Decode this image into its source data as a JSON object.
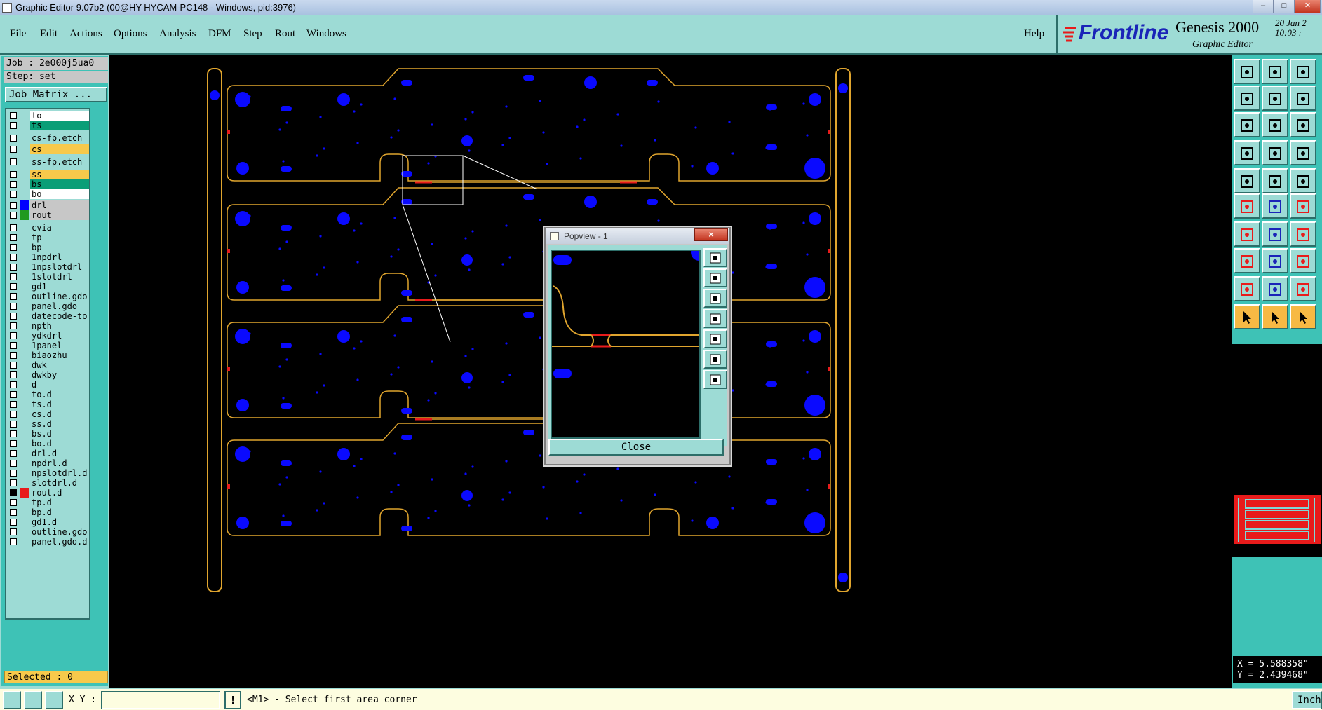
{
  "window": {
    "title": "Graphic Editor 9.07b2 (00@HY-HYCAM-PC148 - Windows, pid:3976)"
  },
  "menu": {
    "items": [
      "File",
      "Edit",
      "Actions",
      "Options",
      "Analysis",
      "DFM",
      "Step",
      "Rout",
      "Windows"
    ],
    "help": "Help"
  },
  "brand": {
    "logo": "Frontline",
    "product": "Genesis 2000",
    "subtitle": "Graphic Editor",
    "date": "20 Jan 2",
    "time": "10:03 :"
  },
  "job": {
    "job_label": "Job : 2e000j5ua0",
    "step_label": "Step: set",
    "matrix_button": "Job Matrix ..."
  },
  "layers": [
    {
      "name": "to",
      "color": "#ffffff",
      "checked": false
    },
    {
      "name": "ts",
      "color": "#0a9e77",
      "checked": false
    },
    {
      "name": "cs-fp.etch",
      "color": "#9ddbd5",
      "checked": false
    },
    {
      "name": "cs",
      "color": "#f7c94b",
      "checked": false
    },
    {
      "name": "ss-fp.etch",
      "color": "#9ddbd5",
      "checked": false
    },
    {
      "name": "ss",
      "color": "#f7c94b",
      "checked": false
    },
    {
      "name": "bs",
      "color": "#0a9e77",
      "checked": false
    },
    {
      "name": "bo",
      "color": "#ffffff",
      "checked": false
    },
    {
      "name": "drl",
      "color": "#c7c7c7",
      "swatch": "#0000ff",
      "checked": false
    },
    {
      "name": "rout",
      "color": "#c7c7c7",
      "swatch": "#1f9a1f",
      "checked": false
    },
    {
      "name": "cvia",
      "color": "#9ddbd5",
      "checked": false
    },
    {
      "name": "tp",
      "color": "#9ddbd5",
      "checked": false
    },
    {
      "name": "bp",
      "color": "#9ddbd5",
      "checked": false
    },
    {
      "name": "1npdrl",
      "color": "#9ddbd5",
      "checked": false
    },
    {
      "name": "1npslotdrl",
      "color": "#9ddbd5",
      "checked": false
    },
    {
      "name": "1slotdrl",
      "color": "#9ddbd5",
      "checked": false
    },
    {
      "name": "gd1",
      "color": "#9ddbd5",
      "checked": false
    },
    {
      "name": "outline.gdo",
      "color": "#9ddbd5",
      "checked": false
    },
    {
      "name": "panel.gdo",
      "color": "#9ddbd5",
      "checked": false
    },
    {
      "name": "datecode-to",
      "color": "#9ddbd5",
      "checked": false
    },
    {
      "name": "npth",
      "color": "#9ddbd5",
      "checked": false
    },
    {
      "name": "ydkdrl",
      "color": "#9ddbd5",
      "checked": false
    },
    {
      "name": "1panel",
      "color": "#9ddbd5",
      "checked": false
    },
    {
      "name": "biaozhu",
      "color": "#9ddbd5",
      "checked": false
    },
    {
      "name": "dwk",
      "color": "#9ddbd5",
      "checked": false
    },
    {
      "name": "dwkby",
      "color": "#9ddbd5",
      "checked": false
    },
    {
      "name": "d",
      "color": "#9ddbd5",
      "checked": false
    },
    {
      "name": "to.d",
      "color": "#9ddbd5",
      "checked": false
    },
    {
      "name": "ts.d",
      "color": "#9ddbd5",
      "checked": false
    },
    {
      "name": "cs.d",
      "color": "#9ddbd5",
      "checked": false
    },
    {
      "name": "ss.d",
      "color": "#9ddbd5",
      "checked": false
    },
    {
      "name": "bs.d",
      "color": "#9ddbd5",
      "checked": false
    },
    {
      "name": "bo.d",
      "color": "#9ddbd5",
      "checked": false
    },
    {
      "name": "drl.d",
      "color": "#9ddbd5",
      "checked": false
    },
    {
      "name": "npdrl.d",
      "color": "#9ddbd5",
      "checked": false
    },
    {
      "name": "npslotdrl.d",
      "color": "#9ddbd5",
      "checked": false
    },
    {
      "name": "slotdrl.d",
      "color": "#9ddbd5",
      "checked": false
    },
    {
      "name": "rout.d",
      "color": "#9ddbd5",
      "swatch": "#e81b1b",
      "checked": true
    },
    {
      "name": "tp.d",
      "color": "#9ddbd5",
      "checked": false
    },
    {
      "name": "bp.d",
      "color": "#9ddbd5",
      "checked": false
    },
    {
      "name": "gd1.d",
      "color": "#9ddbd5",
      "checked": false
    },
    {
      "name": "outline.gdo",
      "color": "#9ddbd5",
      "checked": false
    },
    {
      "name": "panel.gdo.d",
      "color": "#9ddbd5",
      "checked": false
    }
  ],
  "selected": "Selected : 0",
  "popview": {
    "title": "Popview - 1",
    "close_x": "×",
    "close_button": "Close"
  },
  "coords": {
    "x": "X =  5.588358\"",
    "y": "Y =  2.439468\""
  },
  "statusbar": {
    "xy_label": "X Y :",
    "xy_value": "",
    "message": "<M1> - Select first area corner",
    "warn": "!",
    "unit": "Inch"
  },
  "colors": {
    "teal": "#9ddbd5",
    "panel": "#3ec2b6",
    "outline": "#e0a52e",
    "drill": "#0a0aff",
    "rout": "#e81b1b"
  }
}
